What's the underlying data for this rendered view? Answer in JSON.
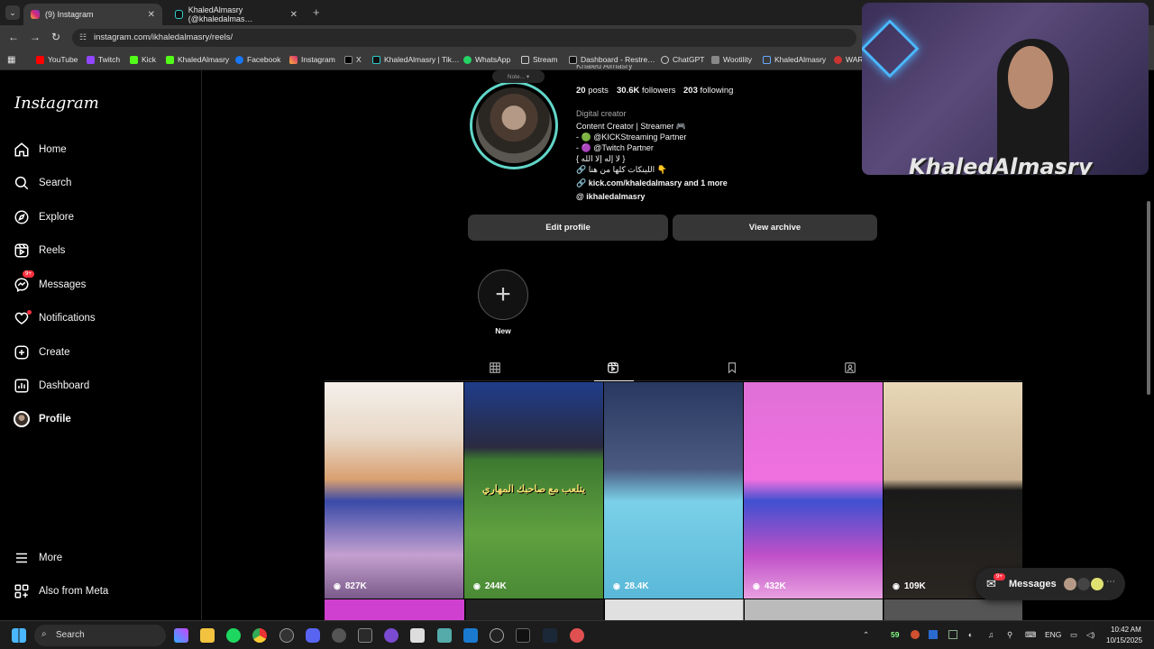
{
  "browser": {
    "tabs": [
      {
        "label": "(9) Instagram",
        "close": "✕"
      },
      {
        "label": "KhaledAlmasry (@khaledalmas…",
        "close": "✕"
      }
    ],
    "new_tab": "+",
    "url": "instagram.com/ikhaledalmasry/reels/",
    "bookmarks": [
      "YouTube",
      "Twitch",
      "Kick",
      "KhaledAlmasry",
      "Facebook",
      "Instagram",
      "X",
      "KhaledAlmasry | Tik…",
      "WhatsApp",
      "Stream",
      "Dashboard - Restre…",
      "ChatGPT",
      "Wootility",
      "KhaledAlmasry",
      "WAR"
    ]
  },
  "sidebar": {
    "logo": "Instagram",
    "items": [
      {
        "label": "Home",
        "icon": "home-icon"
      },
      {
        "label": "Search",
        "icon": "search-icon"
      },
      {
        "label": "Explore",
        "icon": "compass-icon"
      },
      {
        "label": "Reels",
        "icon": "reels-icon"
      },
      {
        "label": "Messages",
        "icon": "messenger-icon",
        "badge": "9+"
      },
      {
        "label": "Notifications",
        "icon": "heart-icon"
      },
      {
        "label": "Create",
        "icon": "plus-square-icon"
      },
      {
        "label": "Dashboard",
        "icon": "dashboard-icon"
      },
      {
        "label": "Profile",
        "icon": "avatar-icon"
      }
    ],
    "bottom": [
      {
        "label": "More",
        "icon": "menu-icon"
      },
      {
        "label": "Also from Meta",
        "icon": "meta-icon"
      }
    ]
  },
  "profile": {
    "note": "Note...",
    "display_name": "Khaled Almasry",
    "posts_num": "20",
    "posts_label": "posts",
    "followers_num": "30.6K",
    "followers_label": "followers",
    "following_num": "203",
    "following_label": "following",
    "category": "Digital creator",
    "bio": [
      "Content Creator | Streamer 🎮",
      "- 🟢 @KICKStreaming Partner",
      "- 🟣 @Twitch Partner",
      "{ لا إله إلا الله }",
      "🔗 اللينكات كلها من هنا 👇"
    ],
    "link": "kick.com/khaledalmasry and 1 more",
    "threads": "ikhaledalmasry",
    "edit_button": "Edit profile",
    "archive_button": "View archive",
    "highlight_new": "New",
    "highlight_plus": "+"
  },
  "reels": [
    {
      "views": "827K",
      "colors": [
        "#f5f0ea",
        "#d9a070",
        "#f0e6da"
      ]
    },
    {
      "views": "244K",
      "colors": [
        "#1f3d8a",
        "#3d7a30",
        "#5fa040"
      ],
      "caption": "يتلعب مع صاحبك المهاري"
    },
    {
      "views": "28.4K",
      "colors": [
        "#283860",
        "#7ad0e8",
        "#5ab8d8"
      ]
    },
    {
      "views": "432K",
      "colors": [
        "#e070d8",
        "#c050c8",
        "#4050d0"
      ]
    },
    {
      "views": "109K",
      "colors": [
        "#e8d8b8",
        "#1a1a1a",
        "#2a2622"
      ]
    }
  ],
  "reel_eye": "◉",
  "webcam": {
    "name": "KhaledAlmasry"
  },
  "messages_pill": {
    "label": "Messages",
    "badge": "9+"
  },
  "taskbar": {
    "search_label": "Search",
    "temp": "59",
    "lang": "ENG",
    "time": "10:42 AM",
    "date": "10/15/2025"
  },
  "colors": {
    "accent": "#61d6c8",
    "badge": "#ff3040",
    "button": "#363636"
  }
}
